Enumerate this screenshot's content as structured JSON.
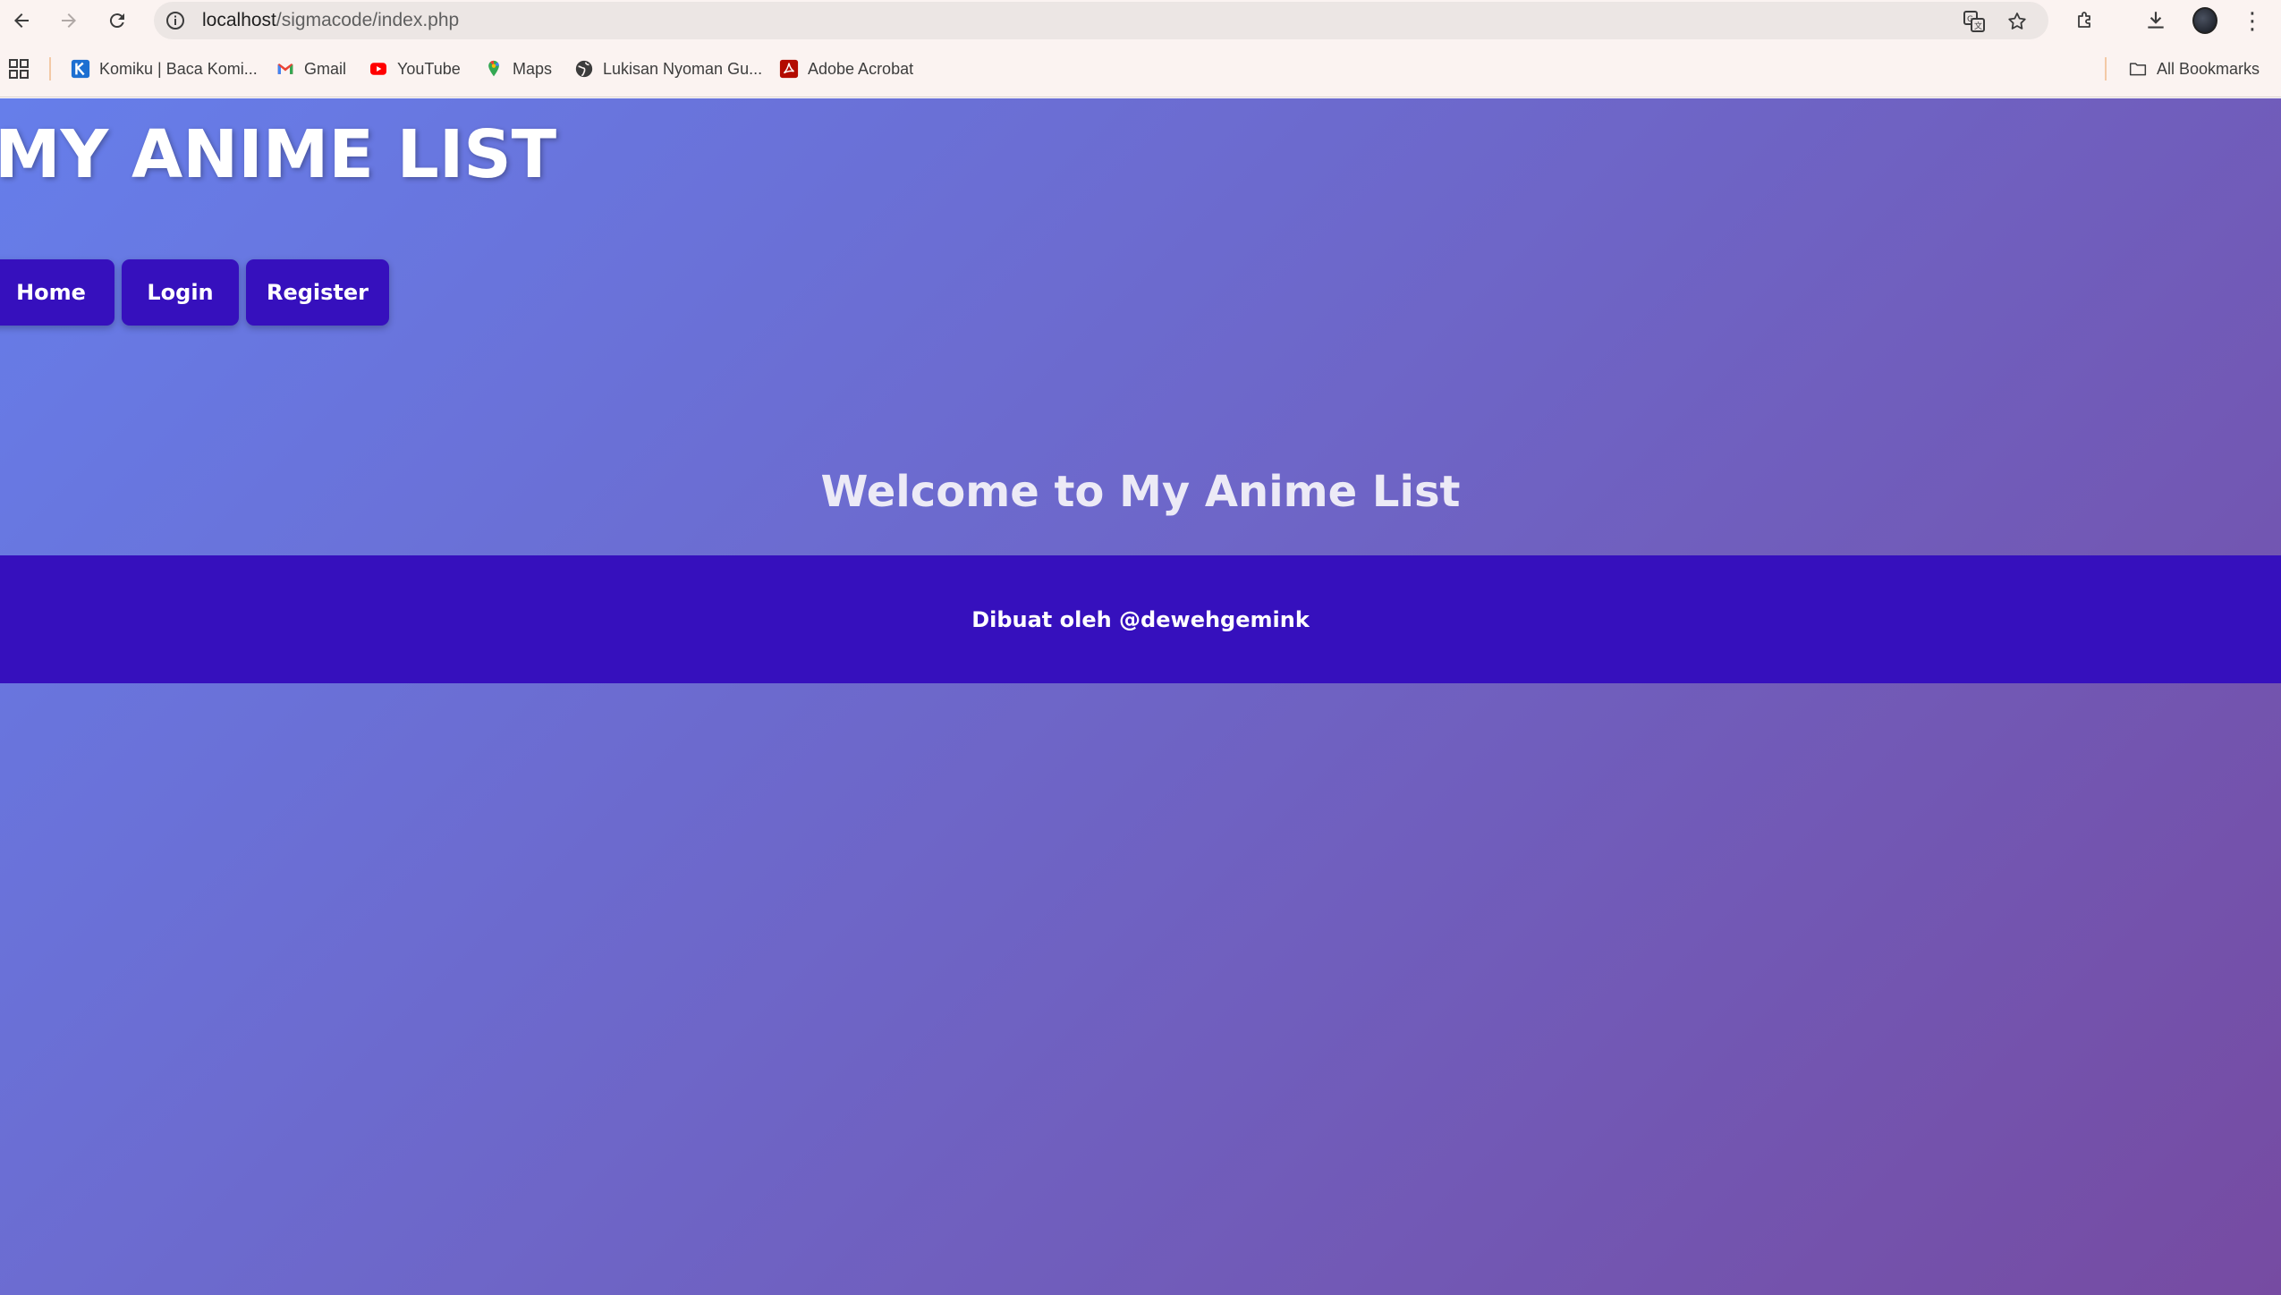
{
  "browser": {
    "url_host": "localhost",
    "url_path": "/sigmacode/index.php",
    "bookmarks": [
      {
        "label": "Komiku | Baca Komi...",
        "icon": "komiku-icon"
      },
      {
        "label": "Gmail",
        "icon": "gmail-icon"
      },
      {
        "label": "YouTube",
        "icon": "youtube-icon"
      },
      {
        "label": "Maps",
        "icon": "maps-icon"
      },
      {
        "label": "Lukisan Nyoman Gu...",
        "icon": "globe-icon"
      },
      {
        "label": "Adobe Acrobat",
        "icon": "acrobat-icon"
      }
    ],
    "all_bookmarks_label": "All Bookmarks"
  },
  "page": {
    "site_title": "MY ANIME LIST",
    "nav": [
      {
        "label": "Home"
      },
      {
        "label": "Login"
      },
      {
        "label": "Register"
      }
    ],
    "welcome": "Welcome to My Anime List",
    "footer": "Dibuat oleh @dewehgemink"
  },
  "colors": {
    "gradient_start": "#667eea",
    "gradient_end": "#764ba2",
    "accent": "#3610bd"
  }
}
